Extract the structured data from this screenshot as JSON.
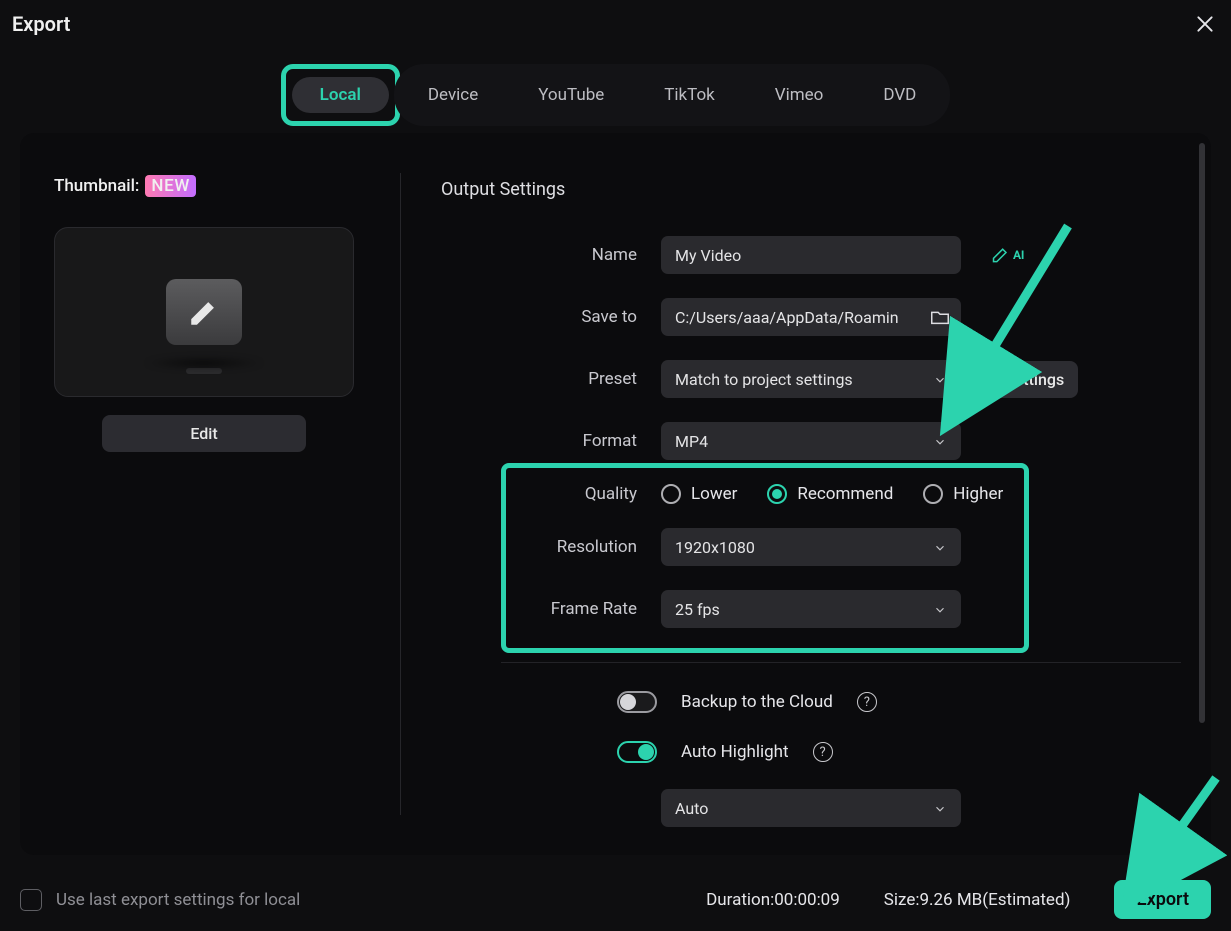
{
  "title": "Export",
  "tabs": [
    "Local",
    "Device",
    "YouTube",
    "TikTok",
    "Vimeo",
    "DVD"
  ],
  "leftcol": {
    "thumbnail_label": "Thumbnail:",
    "new_badge": "NEW",
    "edit": "Edit"
  },
  "section_title": "Output Settings",
  "labels": {
    "name": "Name",
    "saveto": "Save to",
    "preset": "Preset",
    "format": "Format",
    "quality": "Quality",
    "resolution": "Resolution",
    "framerate": "Frame Rate"
  },
  "fields": {
    "name": "My Video",
    "saveto": "C:/Users/aaa/AppData/Roamin",
    "preset": "Match to project settings",
    "format": "MP4",
    "resolution": "1920x1080",
    "framerate": "25 fps",
    "auto_mode": "Auto"
  },
  "ai_label": "AI",
  "settings_btn": "Settings",
  "quality": {
    "lower": "Lower",
    "recommend": "Recommend",
    "higher": "Higher"
  },
  "toggles": {
    "backup": "Backup to the Cloud",
    "autohighlight": "Auto Highlight"
  },
  "bottom": {
    "lastsettings": "Use last export settings for local",
    "duration_label": "Duration:",
    "duration": "00:00:09",
    "size_label": "Size:",
    "size": "9.26 MB",
    "estimated": "(Estimated)",
    "export_btn": "Export"
  },
  "colors": {
    "accent": "#2cd3ae"
  }
}
